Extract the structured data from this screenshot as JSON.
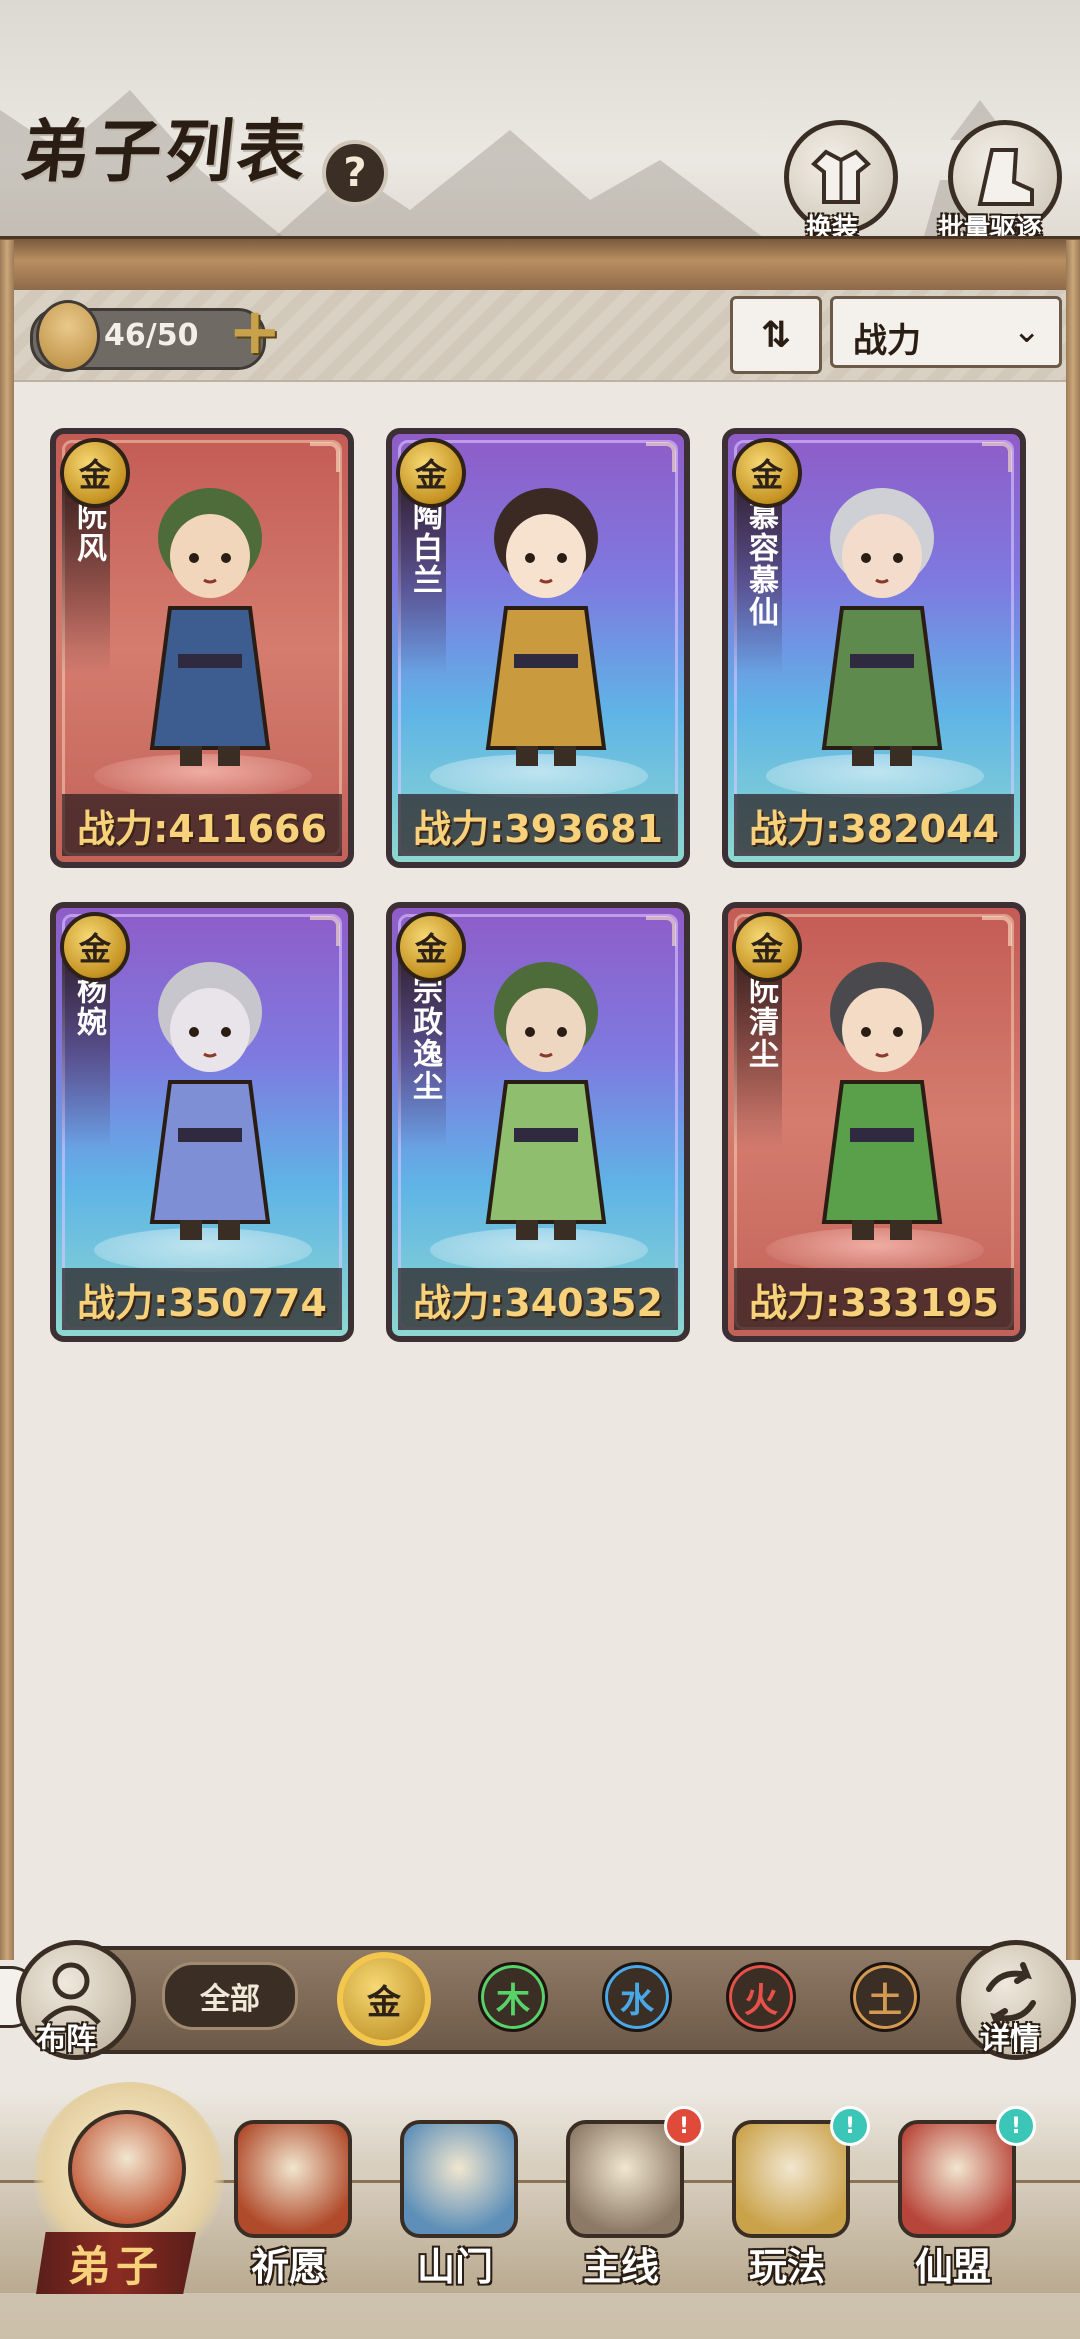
{
  "header": {
    "title": "弟子列表",
    "help_label": "?",
    "change_outfit_label": "换装",
    "batch_expel_label": "批量驱逐"
  },
  "toolbar": {
    "disciple_count": "46/50",
    "add_label": "+",
    "sort_icon": "⇅",
    "sort_dropdown_value": "战力",
    "dropdown_caret": "⌄"
  },
  "cards": [
    {
      "element": "金",
      "name": "阮风",
      "power": "战力:411666",
      "theme": "red"
    },
    {
      "element": "金",
      "name": "陶白兰",
      "power": "战力:393681",
      "theme": "purple"
    },
    {
      "element": "金",
      "name": "慕容慕仙",
      "power": "战力:382044",
      "theme": "purple"
    },
    {
      "element": "金",
      "name": "杨婉",
      "power": "战力:350774",
      "theme": "purple"
    },
    {
      "element": "金",
      "name": "宗政逸尘",
      "power": "战力:340352",
      "theme": "purple"
    },
    {
      "element": "金",
      "name": "阮清尘",
      "power": "战力:333195",
      "theme": "red"
    }
  ],
  "filters": {
    "formation_label": "布阵",
    "all_label": "全部",
    "elements": [
      "金",
      "木",
      "水",
      "火",
      "土"
    ],
    "selected": "金",
    "details_label": "详情",
    "element_colors": {
      "金": "#f3c74e",
      "木": "#58d36a",
      "水": "#49a8e8",
      "火": "#e8504a",
      "土": "#d49a52"
    }
  },
  "nav": {
    "items": [
      "弟子",
      "祈愿",
      "山门",
      "主线",
      "玩法",
      "仙盟"
    ],
    "active": "弟子",
    "badges": {
      "主线": "!",
      "玩法": "!",
      "仙盟": "!"
    }
  }
}
